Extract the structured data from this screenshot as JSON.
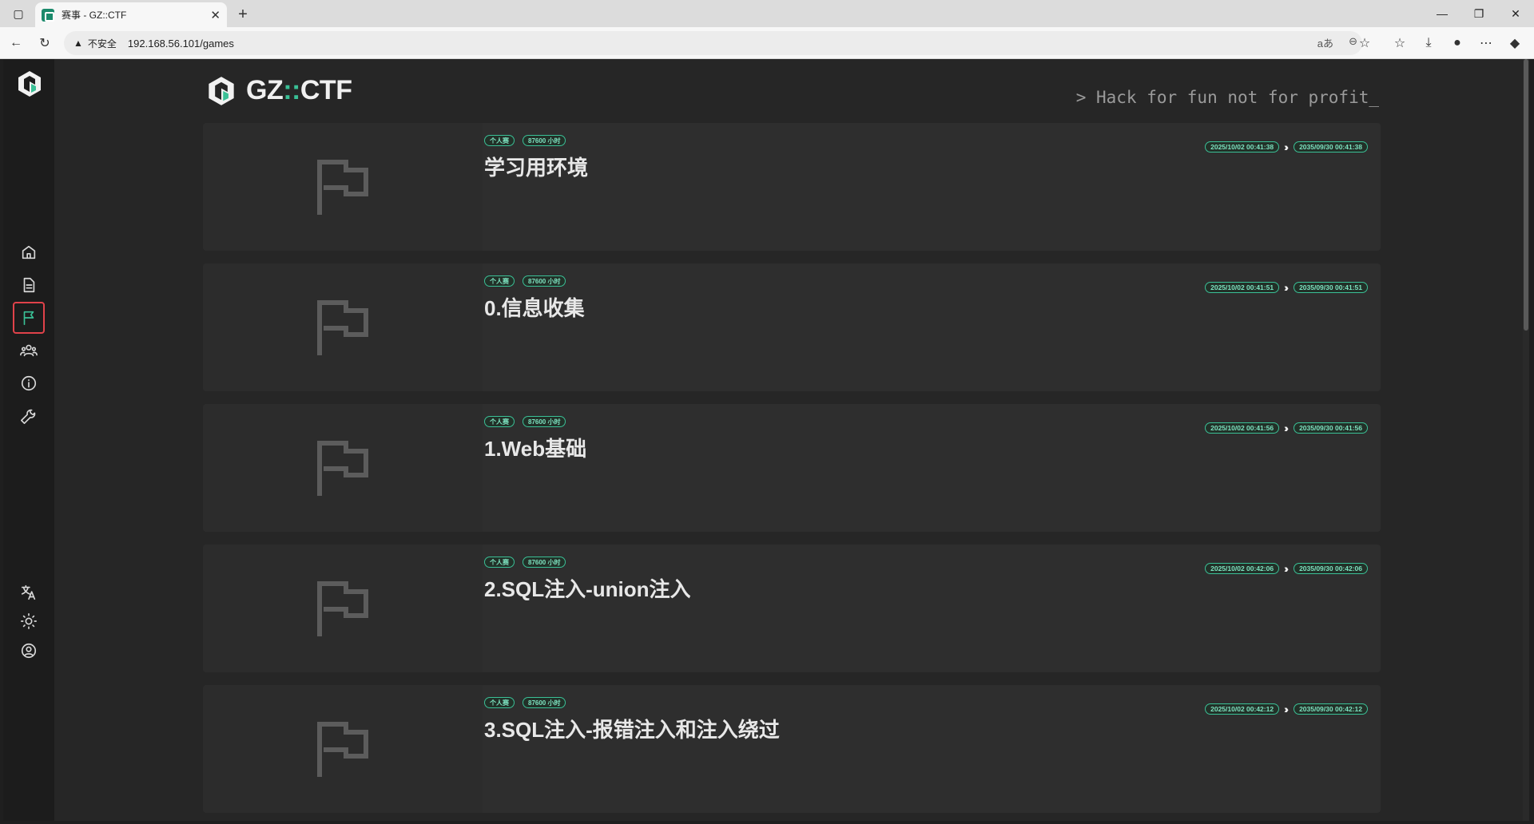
{
  "browser": {
    "tab_title": "赛事 - GZ::CTF",
    "tab_close": "✕",
    "new_tab": "+",
    "security_label": "不安全",
    "url": "192.168.56.101/games"
  },
  "brand": {
    "name_left": "GZ",
    "name_sep": "::",
    "name_right": "CTF",
    "slogan": "> Hack for fun not for profit_"
  },
  "sidebar": {
    "items": [
      {
        "name": "home-icon"
      },
      {
        "name": "posts-icon"
      },
      {
        "name": "games-icon",
        "active": true
      },
      {
        "name": "teams-icon"
      },
      {
        "name": "about-icon"
      },
      {
        "name": "admin-icon"
      }
    ],
    "bottom": [
      {
        "name": "language-icon"
      },
      {
        "name": "theme-icon"
      },
      {
        "name": "user-icon"
      }
    ]
  },
  "games": [
    {
      "tag": "个人赛",
      "duration": "87600 小时",
      "title": "学习用环境",
      "start": "2025/10/02 00:41:38",
      "end": "2035/09/30 00:41:38"
    },
    {
      "tag": "个人赛",
      "duration": "87600 小时",
      "title": "0.信息收集",
      "start": "2025/10/02 00:41:51",
      "end": "2035/09/30 00:41:51"
    },
    {
      "tag": "个人赛",
      "duration": "87600 小时",
      "title": "1.Web基础",
      "start": "2025/10/02 00:41:56",
      "end": "2035/09/30 00:41:56"
    },
    {
      "tag": "个人赛",
      "duration": "87600 小时",
      "title": "2.SQL注入-union注入",
      "start": "2025/10/02 00:42:06",
      "end": "2035/09/30 00:42:06"
    },
    {
      "tag": "个人赛",
      "duration": "87600 小时",
      "title": "3.SQL注入-报错注入和注入绕过",
      "start": "2025/10/02 00:42:12",
      "end": "2035/09/30 00:42:12"
    }
  ],
  "colors": {
    "accent": "#3ac096",
    "highlight_box": "#e0424a",
    "background": "#262626"
  }
}
